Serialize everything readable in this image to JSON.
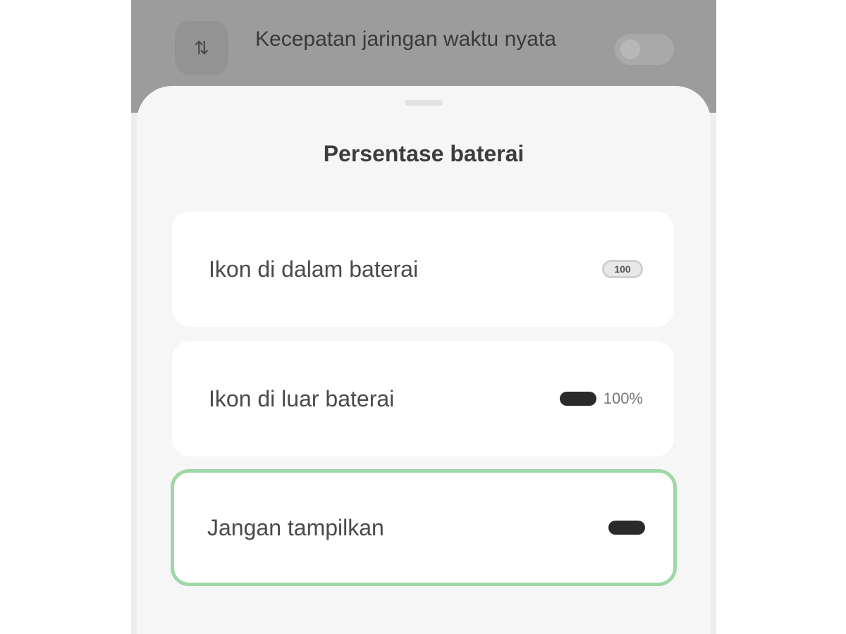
{
  "background_row": {
    "icon": "network-speed-icon",
    "label": "Kecepatan jaringan waktu nyata",
    "toggle_on": false
  },
  "sheet": {
    "title": "Persentase baterai",
    "options": [
      {
        "label": "Ikon di dalam baterai",
        "preview_icon": "battery-inside-icon",
        "preview_text": "100",
        "selected": false
      },
      {
        "label": "Ikon di luar baterai",
        "preview_icon": "battery-outside-icon",
        "preview_text": "100%",
        "selected": false
      },
      {
        "label": "Jangan tampilkan",
        "preview_icon": "battery-plain-icon",
        "preview_text": "",
        "selected": true
      }
    ]
  },
  "colors": {
    "selected_border": "#9ed8a6",
    "sheet_background": "#f6f6f6",
    "dim_overlay": "#9c9c9c"
  }
}
